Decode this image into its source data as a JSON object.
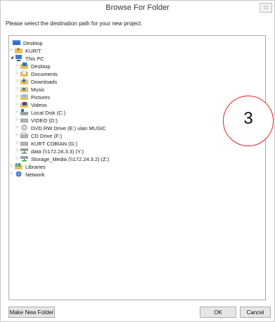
{
  "window": {
    "title": "Browse For Folder",
    "maximize_glyph": "□",
    "instructions": "Please select the destination path for your new project."
  },
  "tree": {
    "items": [
      {
        "label": "Desktop",
        "icon": "desktop-icon",
        "selected": false
      },
      {
        "label": "KURIT",
        "icon": "user-folder-icon"
      },
      {
        "label": "This PC",
        "icon": "computer-icon"
      },
      {
        "label": "Desktop",
        "icon": "desktop-folder-icon"
      },
      {
        "label": "Documents",
        "icon": "documents-folder-icon"
      },
      {
        "label": "Downloads",
        "icon": "downloads-folder-icon"
      },
      {
        "label": "Music",
        "icon": "music-folder-icon"
      },
      {
        "label": "Pictures",
        "icon": "pictures-folder-icon"
      },
      {
        "label": "Videos",
        "icon": "videos-folder-icon"
      },
      {
        "label": "Local Disk (C:)",
        "icon": "local-disk-icon"
      },
      {
        "label": "VIDEO (D:)",
        "icon": "drive-icon"
      },
      {
        "label": "DVD RW Drive (E:) ulan MUSIC",
        "icon": "dvd-drive-icon"
      },
      {
        "label": "CD Drive (F:)",
        "icon": "cd-drive-icon"
      },
      {
        "label": "KURT COBIAN (G:)",
        "icon": "drive-icon"
      },
      {
        "label": "data (\\\\172.24.3.3) (Y:)",
        "icon": "network-drive-icon"
      },
      {
        "label": "Storage_Media (\\\\172.24.3.2) (Z:)",
        "icon": "network-drive-icon"
      },
      {
        "label": "Libraries",
        "icon": "libraries-icon"
      },
      {
        "label": "Network",
        "icon": "network-icon"
      }
    ]
  },
  "buttons": {
    "make_new_folder": "Make New Folder",
    "ok": "OK",
    "cancel": "Cancel"
  },
  "annotation": {
    "number": "3",
    "color": "#dd2222"
  },
  "colors": {
    "folder": "#e8c15a",
    "desktop": "#2a6fc9",
    "arrow": "#8a8a8a"
  }
}
